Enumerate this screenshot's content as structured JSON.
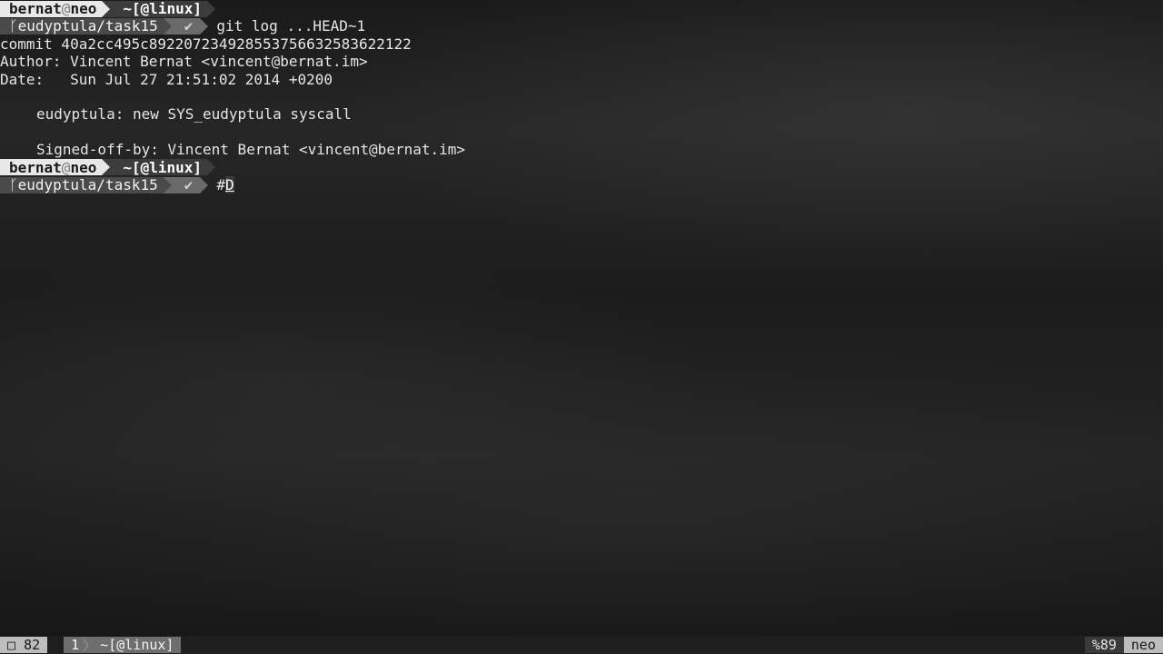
{
  "prompt1": {
    "user": "bernat",
    "at": "@",
    "host": "neo",
    "dir": "~[@linux]",
    "branch_icon": "branch-icon",
    "branch_glyph": "ᚴ",
    "branch": "eudyptula/task15",
    "ok_glyph": "✔",
    "command": "git log ...HEAD~1"
  },
  "log": {
    "commit": "commit 40a2cc495c89220723492855375663258362212​2",
    "author": "Author: Vincent Bernat <vincent@bernat.im>",
    "date": "Date:   Sun Jul 27 21:51:02 2014 +0200",
    "subject": "eudyptula: new SYS_eudyptula syscall",
    "signoff": "Signed-off-by: Vincent Bernat <vincent@bernat.im>"
  },
  "prompt2": {
    "user": "bernat",
    "at": "@",
    "host": "neo",
    "dir": "~[@linux]",
    "branch_glyph": "ᚴ",
    "branch": "eudyptula/task15",
    "ok_glyph": "✔",
    "hash": "#",
    "typed": "D"
  },
  "status_bar": {
    "window_glyph": "□",
    "window_count": "82",
    "index": "1",
    "window_name": "~[@linux]",
    "percent": "%89",
    "host": "neo"
  }
}
